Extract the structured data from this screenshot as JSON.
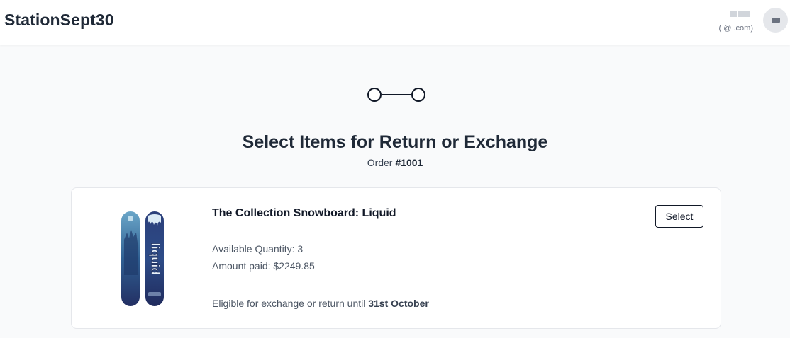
{
  "header": {
    "store_name": "StationSept30",
    "user_email": "(                  @              .com)"
  },
  "stepper": {
    "steps": 2,
    "current": 1
  },
  "page": {
    "title": "Select Items for Return or Exchange",
    "order_prefix": "Order ",
    "order_number": "#1001"
  },
  "items": [
    {
      "title": "The Collection Snowboard: Liquid",
      "available_quantity": "Available Quantity: 3",
      "amount_paid": "Amount paid: $2249.85",
      "eligible_prefix": "Eligible for exchange or return until ",
      "eligible_date": "31st October",
      "select_label": "Select"
    }
  ]
}
